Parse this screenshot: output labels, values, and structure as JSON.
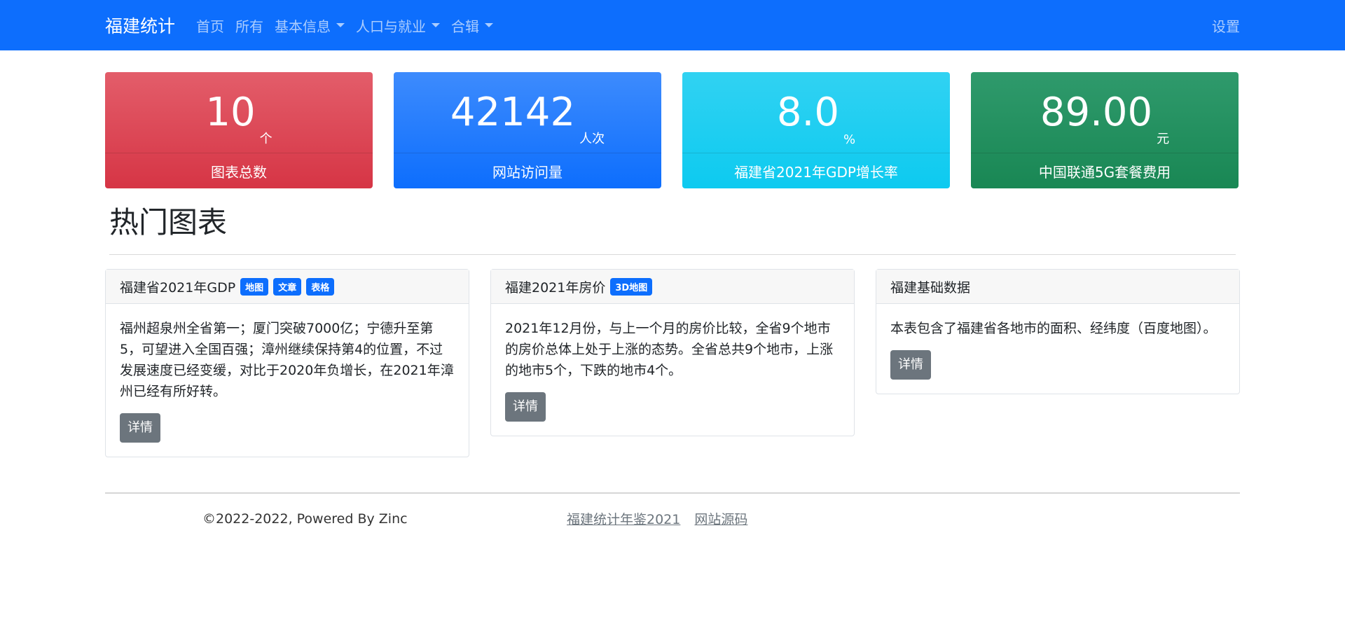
{
  "navbar": {
    "brand": "福建统计",
    "items": [
      {
        "label": "首页",
        "dropdown": false
      },
      {
        "label": "所有",
        "dropdown": false
      },
      {
        "label": "基本信息",
        "dropdown": true
      },
      {
        "label": "人口与就业",
        "dropdown": true
      },
      {
        "label": "合辑",
        "dropdown": true
      }
    ],
    "settings": "设置"
  },
  "stats": [
    {
      "value": "10",
      "unit": "个",
      "label": "图表总数",
      "color": "#dc3545"
    },
    {
      "value": "42142",
      "unit": "人次",
      "label": "网站访问量",
      "color": "#0d6efd"
    },
    {
      "value": "8.0",
      "unit": "%",
      "label": "福建省2021年GDP增长率",
      "color": "#0dcaf0"
    },
    {
      "value": "89.00",
      "unit": "元",
      "label": "中国联通5G套餐费用",
      "color": "#198754"
    }
  ],
  "section": {
    "title": "热门图表"
  },
  "cards": [
    {
      "title": "福建省2021年GDP",
      "badges": [
        "地图",
        "文章",
        "表格"
      ],
      "text": "福州超泉州全省第一；厦门突破7000亿；宁德升至第5，可望进入全国百强；漳州继续保持第4的位置，不过发展速度已经变缓，对比于2020年负增长，在2021年漳州已经有所好转。",
      "button": "详情"
    },
    {
      "title": "福建2021年房价",
      "badges": [
        "3D地图"
      ],
      "text": "2021年12月份，与上一个月的房价比较，全省9个地市的房价总体上处于上涨的态势。全省总共9个地市，上涨的地市5个，下跌的地市4个。",
      "button": "详情"
    },
    {
      "title": "福建基础数据",
      "badges": [],
      "text": "本表包含了福建省各地市的面积、经纬度（百度地图）。",
      "button": "详情"
    }
  ],
  "footer": {
    "copyright": "©2022-2022, Powered By Zinc",
    "links": [
      "福建统计年鉴2021",
      "网站源码"
    ]
  },
  "colors": {
    "primary": "#0d6efd",
    "secondary": "#6c757d"
  }
}
